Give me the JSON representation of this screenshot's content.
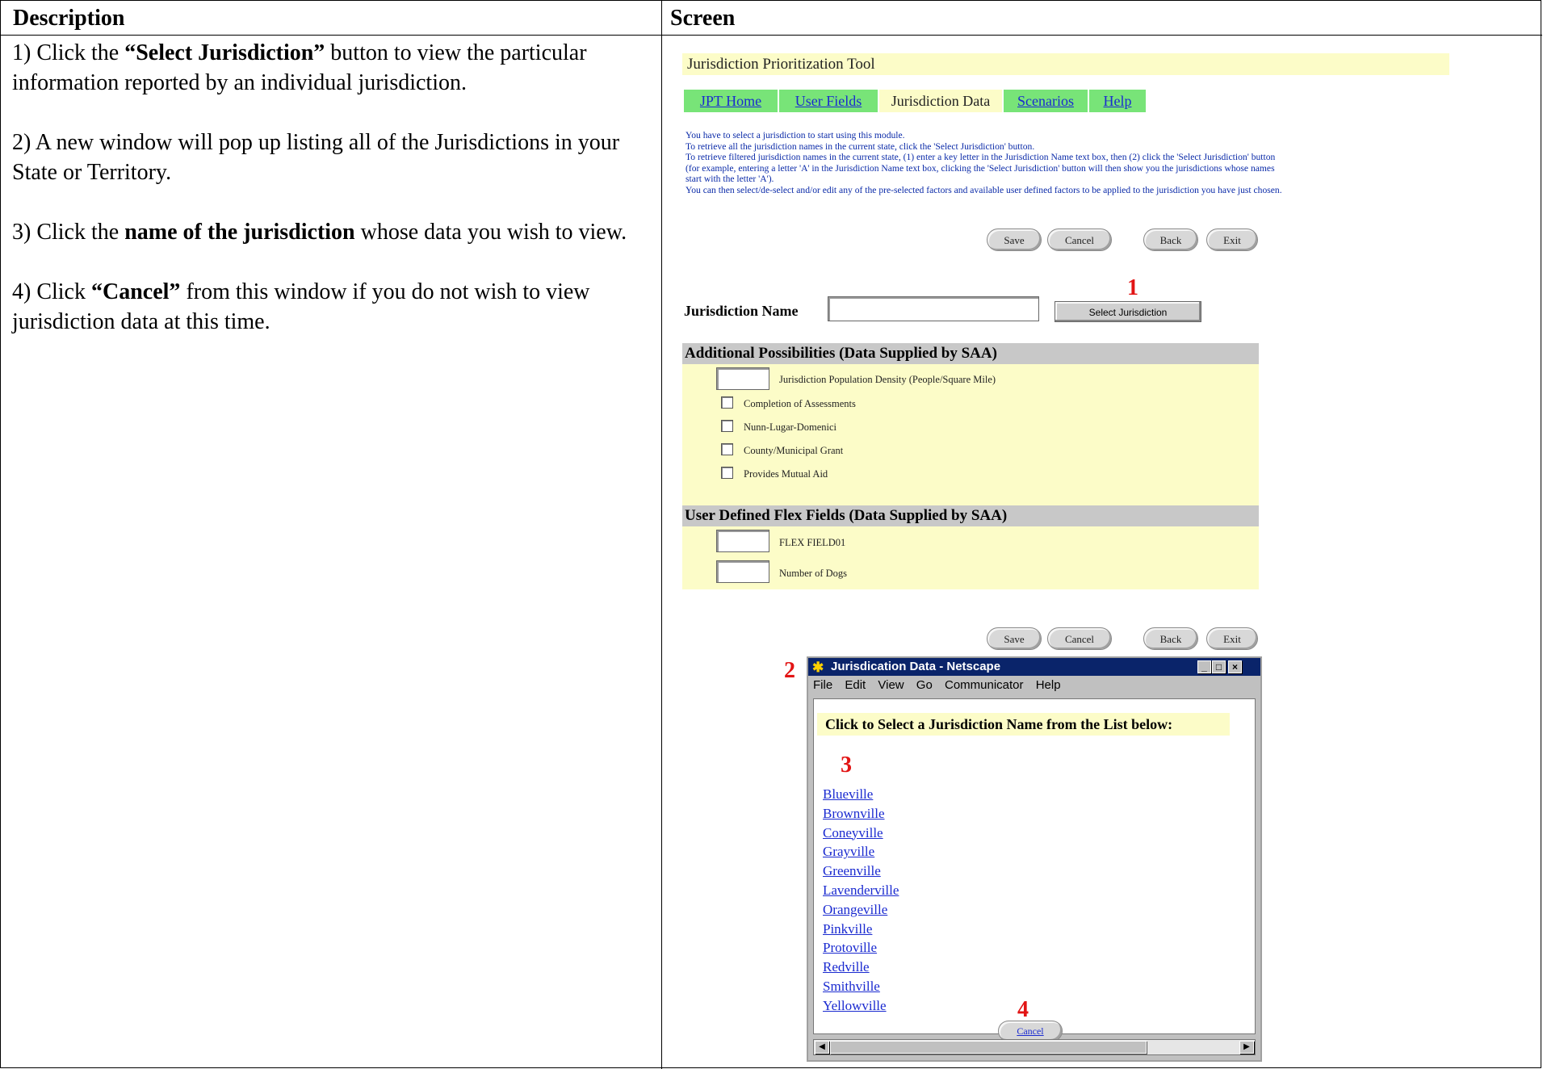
{
  "table": {
    "col1_header": "Description",
    "col2_header": "Screen"
  },
  "description": {
    "step1_pre": "1) Click the ",
    "step1_bold": "“Select Jurisdiction”",
    "step1_post": " button to view the particular information reported by an individual jurisdiction.",
    "step2": "2) A new window will pop up listing all of the Jurisdictions in your State or Territory.",
    "step3_pre": "3) Click the ",
    "step3_bold": "name of the jurisdiction",
    "step3_post": " whose data you wish to view.",
    "step4_pre": "4) Click ",
    "step4_bold": "“Cancel”",
    "step4_post": " from this window if you do not wish to view jurisdiction data at this time."
  },
  "screen": {
    "app_title": "Jurisdiction Prioritization Tool",
    "tabs": [
      "JPT Home",
      "User Fields",
      "Jurisdiction Data",
      "Scenarios",
      "Help"
    ],
    "instructions": [
      "You have to select a jurisdiction to start using this module.",
      "To retrieve all the jurisdiction names in the current state, click the 'Select Jurisdiction' button.",
      "To retrieve filtered jurisdiction names in the current state, (1) enter a key letter in the Jurisdiction Name text box, then (2) click the 'Select Jurisdiction' button",
      "(for example, entering a letter 'A' in the Jurisdiction Name text box, clicking the 'Select Jurisdiction' button will then show you the jurisdictions whose names",
      "start with the letter 'A').",
      "You can then select/de-select and/or edit any of the pre-selected factors and available user defined factors to be applied to the jurisdiction you have just chosen."
    ],
    "buttons": {
      "save": "Save",
      "cancel": "Cancel",
      "back": "Back",
      "exit": "Exit"
    },
    "jurisdiction_name_label": "Jurisdiction Name",
    "jurisdiction_name_value": "",
    "select_button": "Select Jurisdiction",
    "markers": [
      "1",
      "2",
      "3",
      "4"
    ],
    "additional": {
      "header": "Additional Possibilities (Data Supplied by SAA)",
      "density_label": "Jurisdiction Population Density (People/Square Mile)",
      "checkboxes": [
        "Completion of Assessments",
        "Nunn-Lugar-Domenici",
        "County/Municipal Grant",
        "Provides Mutual Aid"
      ]
    },
    "flex": {
      "header": "User Defined Flex Fields (Data Supplied by SAA)",
      "fields": [
        "FLEX FIELD01",
        "Number of Dogs"
      ]
    },
    "popup": {
      "title": "Jurisdication Data - Netscape",
      "menu": [
        "File",
        "Edit",
        "View",
        "Go",
        "Communicator",
        "Help"
      ],
      "heading": "Click to Select a Jurisdiction Name from the List below:",
      "jurisdictions": [
        "Blueville",
        "Brownville",
        "Coneyville",
        "Grayville",
        "Greenville",
        "Lavenderville",
        "Orangeville",
        "Pinkville",
        "Protoville",
        "Redville",
        "Smithville",
        "Yellowville"
      ],
      "cancel": "Cancel"
    }
  }
}
